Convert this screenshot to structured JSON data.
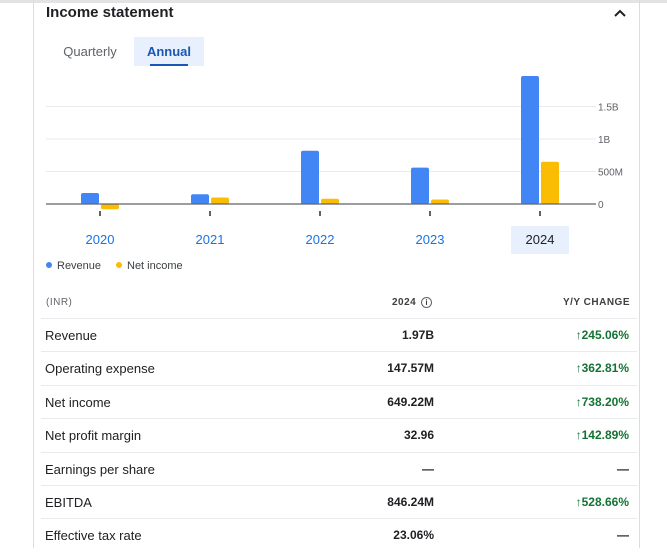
{
  "title": "Income statement",
  "tabs": [
    {
      "label": "Quarterly",
      "selected": false
    },
    {
      "label": "Annual",
      "selected": true
    }
  ],
  "chart_data": {
    "type": "bar",
    "categories": [
      "2020",
      "2021",
      "2022",
      "2023",
      "2024"
    ],
    "selected_category": "2024",
    "series": [
      {
        "name": "Revenue",
        "color": "#4285f4",
        "values": [
          0.17,
          0.15,
          0.82,
          0.56,
          1.97
        ]
      },
      {
        "name": "Net income",
        "color": "#fbbc04",
        "values": [
          -0.08,
          0.1,
          0.08,
          0.07,
          0.65
        ]
      }
    ],
    "unit": "B",
    "yticks": [
      {
        "value": 0,
        "label": "0"
      },
      {
        "value": 0.5,
        "label": "500M"
      },
      {
        "value": 1.0,
        "label": "1B"
      },
      {
        "value": 1.5,
        "label": "1.5B"
      }
    ],
    "ylim": [
      -0.25,
      2.0
    ],
    "legend_position": "bottom-left"
  },
  "table": {
    "header": {
      "currency": "(INR)",
      "year": "2024",
      "change": "Y/Y CHANGE"
    },
    "rows": [
      {
        "label": "Revenue",
        "value": "1.97B",
        "change": "↑245.06%",
        "trend": "up"
      },
      {
        "label": "Operating expense",
        "value": "147.57M",
        "change": "↑362.81%",
        "trend": "up"
      },
      {
        "label": "Net income",
        "value": "649.22M",
        "change": "↑738.20%",
        "trend": "up"
      },
      {
        "label": "Net profit margin",
        "value": "32.96",
        "change": "↑142.89%",
        "trend": "up"
      },
      {
        "label": "Earnings per share",
        "value": "—",
        "change": "—",
        "trend": "none"
      },
      {
        "label": "EBITDA",
        "value": "846.24M",
        "change": "↑528.66%",
        "trend": "up"
      },
      {
        "label": "Effective tax rate",
        "value": "23.06%",
        "change": "—",
        "trend": "none"
      }
    ]
  }
}
